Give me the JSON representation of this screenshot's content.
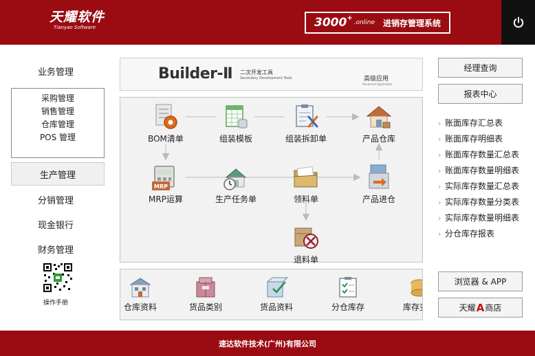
{
  "header": {
    "logo_cn": "天耀软件",
    "logo_en": "Tianyao Software",
    "sys_num": "3000",
    "sys_plus": "+",
    "sys_online": ".online",
    "sys_name": "进销存管理系统"
  },
  "nav": {
    "business": "业务管理",
    "sub_items": [
      "采购管理",
      "销售管理",
      "仓库管理",
      "POS 管理"
    ],
    "production": "生产管理",
    "distribution": "分销管理",
    "cash_bank": "现金银行",
    "finance": "财务管理",
    "manual": "操作手册"
  },
  "banner": {
    "title": "Builder-Ⅱ",
    "sub_cn": "二次开发工具",
    "sub_en": "Secondary Development Tools",
    "adv_cn": "高级应用",
    "adv_en": "Advanced Application"
  },
  "flow": {
    "bom": "BOM清单",
    "assembly_template": "组装模板",
    "assembly_disassembly": "组装拆卸单",
    "product_warehouse": "产品仓库",
    "mrp": "MRP运算",
    "production_task": "生产任务单",
    "material_requisition": "领料单",
    "product_inbound": "产品进仓",
    "material_return": "退料单",
    "mrp_icon_text": "MRP"
  },
  "strip": {
    "items": [
      "仓库资料",
      "货品类别",
      "货品资料",
      "分仓库存",
      "库存变动"
    ]
  },
  "right": {
    "manager_query": "经理查询",
    "report_center": "报表中心",
    "reports": [
      "账面库存汇总表",
      "账面库存明细表",
      "账面库存数量汇总表",
      "账面库存数量明细表",
      "实际库存数量汇总表",
      "实际库存数量分类表",
      "实际库存数量明细表",
      "分仓库存报表"
    ],
    "browser_app": "浏览器 & APP",
    "shop_pre": "天耀",
    "shop_a": "A",
    "shop_post": "商店"
  },
  "footer": {
    "company": "速达软件技术(广州)有限公司"
  },
  "colors": {
    "brand_red": "#9a0c12",
    "panel_gray": "#f2f2f2",
    "accent_orange": "#e06a20"
  }
}
